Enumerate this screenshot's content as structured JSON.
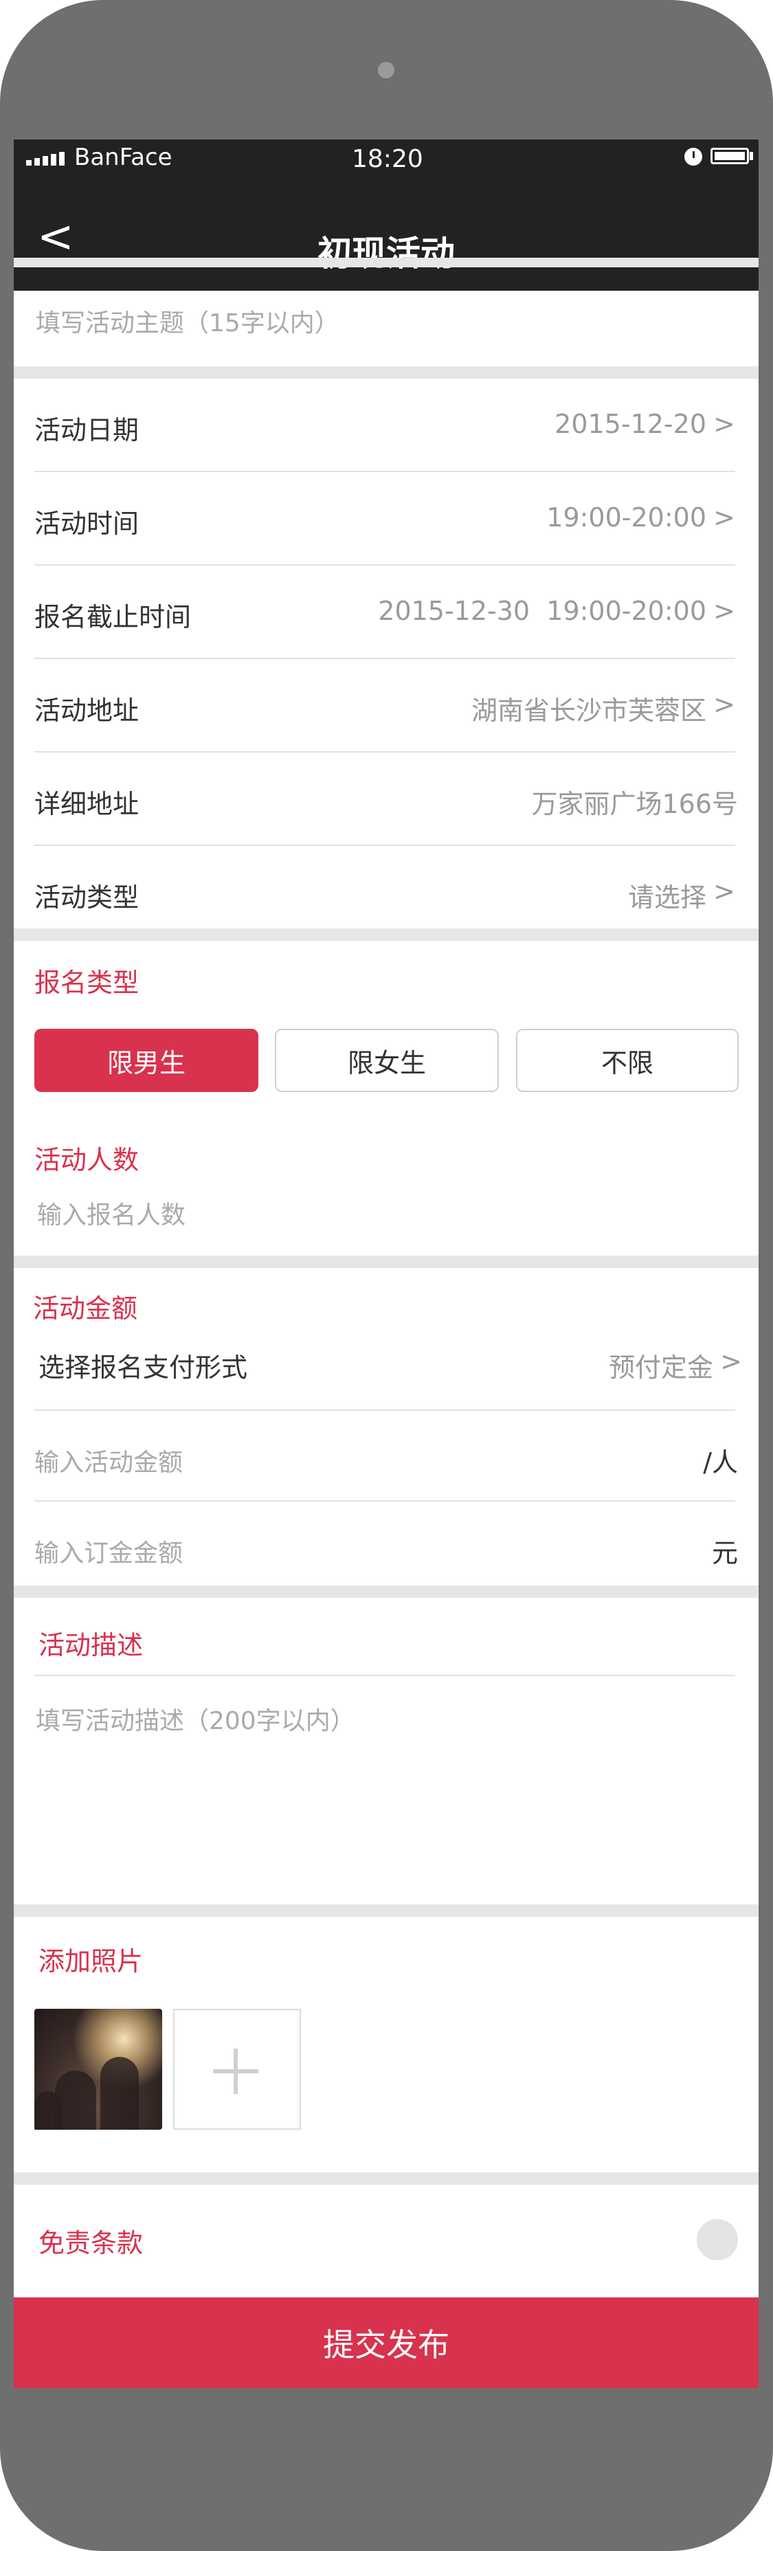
{
  "status_bar": {
    "carrier": "BanFace",
    "time": "18:20"
  },
  "nav": {
    "back_glyph": "<",
    "title": "初现活动"
  },
  "topic": {
    "placeholder": "填写活动主题（15字以内）"
  },
  "rows": [
    {
      "label": "活动日期",
      "value": "2015-12-20",
      "chevron": true
    },
    {
      "label": "活动时间",
      "value": "19:00-20:00",
      "chevron": true
    },
    {
      "label": "报名截止时间",
      "value": "2015-12-30  19:00-20:00",
      "chevron": true
    },
    {
      "label": "活动地址",
      "value": "湖南省长沙市芙蓉区",
      "chevron": true
    },
    {
      "label": "详细地址",
      "value": "万家丽广场166号",
      "chevron": false
    },
    {
      "label": "活动类型",
      "value": "请选择",
      "chevron": true
    }
  ],
  "signup_type": {
    "heading": "报名类型",
    "options": [
      "限男生",
      "限女生",
      "不限"
    ],
    "selected": "限男生"
  },
  "headcount": {
    "heading": "活动人数",
    "placeholder": "输入报名人数"
  },
  "fee": {
    "heading": "活动金额",
    "payment_label": "选择报名支付形式",
    "payment_value": "预付定金",
    "amount_placeholder": "输入活动金额",
    "amount_unit": "/人",
    "deposit_placeholder": "输入订金金额",
    "deposit_unit": "元"
  },
  "description": {
    "heading": "活动描述",
    "placeholder": "填写活动描述（200字以内）"
  },
  "photos": {
    "heading": "添加照片",
    "add_icon": "plus-icon"
  },
  "disclaimer": {
    "heading": "免责条款"
  },
  "submit": {
    "label": "提交发布"
  },
  "chevron_glyph": ">",
  "colors": {
    "accent": "#d8324e",
    "bar": "#222222",
    "divider": "#e6e6e6",
    "frame": "#6f6f6f"
  }
}
